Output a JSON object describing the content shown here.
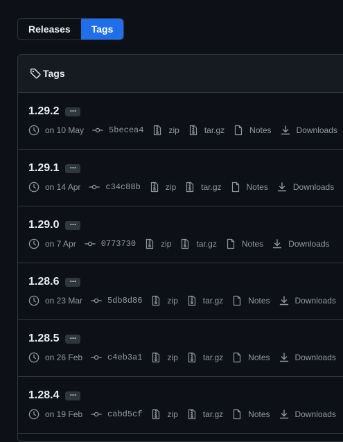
{
  "toggle": {
    "releases_label": "Releases",
    "tags_label": "Tags",
    "selected": "Tags"
  },
  "box": {
    "header_title": "Tags",
    "header_icon": "tag-icon"
  },
  "colors": {
    "background": "#0d1117",
    "header_bg": "#161b22",
    "border": "#30363d",
    "accent": "#1f6feb",
    "muted_text": "#9198a1",
    "text": "#e6edf3"
  },
  "tags": [
    {
      "name": "1.29.2",
      "date": "on 10 May",
      "sha": "5becea4",
      "zip": "zip",
      "targz": "tar.gz",
      "notes": "Notes",
      "downloads": "Downloads"
    },
    {
      "name": "1.29.1",
      "date": "on 14 Apr",
      "sha": "c34c88b",
      "zip": "zip",
      "targz": "tar.gz",
      "notes": "Notes",
      "downloads": "Downloads"
    },
    {
      "name": "1.29.0",
      "date": "on 7 Apr",
      "sha": "0773730",
      "zip": "zip",
      "targz": "tar.gz",
      "notes": "Notes",
      "downloads": "Downloads"
    },
    {
      "name": "1.28.6",
      "date": "on 23 Mar",
      "sha": "5db8d86",
      "zip": "zip",
      "targz": "tar.gz",
      "notes": "Notes",
      "downloads": "Downloads"
    },
    {
      "name": "1.28.5",
      "date": "on 26 Feb",
      "sha": "c4eb3a1",
      "zip": "zip",
      "targz": "tar.gz",
      "notes": "Notes",
      "downloads": "Downloads"
    },
    {
      "name": "1.28.4",
      "date": "on 19 Feb",
      "sha": "cabd5cf",
      "zip": "zip",
      "targz": "tar.gz",
      "notes": "Notes",
      "downloads": "Downloads"
    }
  ],
  "ellipsis": "···"
}
